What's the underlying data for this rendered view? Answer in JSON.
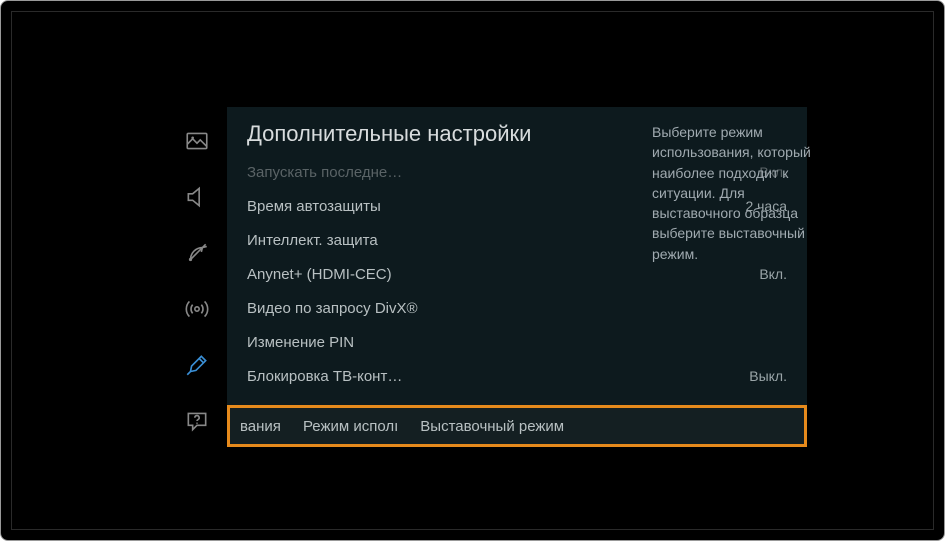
{
  "title": "Дополнительные настройки",
  "sidebar": {
    "items": [
      {
        "name": "picture-icon"
      },
      {
        "name": "sound-icon"
      },
      {
        "name": "broadcast-icon"
      },
      {
        "name": "network-icon"
      },
      {
        "name": "system-icon"
      },
      {
        "name": "support-icon"
      }
    ],
    "active_index": 4
  },
  "menu": {
    "items": [
      {
        "label": "Запускать последне…",
        "value": "Вкл.",
        "dimmed": true
      },
      {
        "label": "Время автозащиты",
        "value": "2 часа",
        "dimmed": false
      },
      {
        "label": "Интеллект. защита",
        "value": "",
        "dimmed": false
      },
      {
        "label": "Anynet+ (HDMI-CEC)",
        "value": "Вкл.",
        "dimmed": false
      },
      {
        "label": "Видео по запросу DivX®",
        "value": "",
        "dimmed": false
      },
      {
        "label": "Изменение PIN",
        "value": "",
        "dimmed": false
      },
      {
        "label": "Блокировка ТВ-конт…",
        "value": "Выкл.",
        "dimmed": false
      }
    ]
  },
  "footer": {
    "cells": [
      "вания",
      "Режим исполı",
      "Выставочный режим"
    ]
  },
  "help": {
    "text": "Выберите режим использования, который наиболее подходит к ситуации. Для выставочного образца выберите выставочный режим."
  }
}
